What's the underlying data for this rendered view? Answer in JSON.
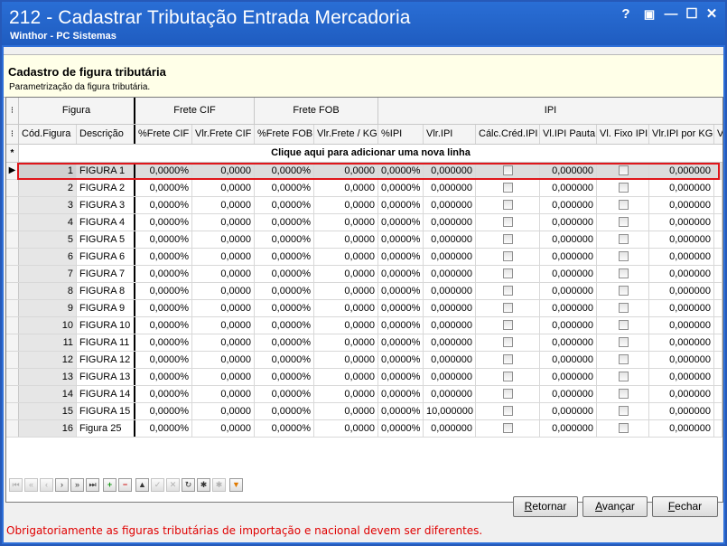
{
  "window": {
    "title": "212 - Cadastrar Tributação Entrada Mercadoria",
    "subtitle": "Winthor - PC Sistemas",
    "controls": [
      "?",
      "▣",
      "—",
      "☐",
      "✕"
    ]
  },
  "header": {
    "title": "Cadastro de figura tributária",
    "subtitle": "Parametrização da figura tributária."
  },
  "grid": {
    "bands": [
      "Figura",
      "Frete CIF",
      "Frete FOB",
      "IPI"
    ],
    "columns": [
      "Cód.Figura",
      "Descrição",
      "%Frete CIF",
      "Vlr.Frete CIF",
      "%Frete FOB",
      "Vlr.Frete / KG",
      "%IPI",
      "Vlr.IPI",
      "Cálc.Créd.IPI",
      "Vl.IPI Pauta",
      "Vl. Fixo IPI",
      "Vlr.IPI por KG",
      "V"
    ],
    "new_row_text": "Clique aqui para adicionar uma nova linha",
    "rows": [
      {
        "code": "1",
        "desc": "FIGURA 1",
        "frete_cif_pct": "0,0000%",
        "frete_cif_vlr": "0,0000",
        "frete_fob_pct": "0,0000%",
        "frete_kg": "0,0000",
        "ipi_pct": "0,0000%",
        "ipi_vlr": "0,000000",
        "ipi_pauta": "0,000000",
        "ipi_kg": "0,000000"
      },
      {
        "code": "2",
        "desc": "FIGURA 2",
        "frete_cif_pct": "0,0000%",
        "frete_cif_vlr": "0,0000",
        "frete_fob_pct": "0,0000%",
        "frete_kg": "0,0000",
        "ipi_pct": "0,0000%",
        "ipi_vlr": "0,000000",
        "ipi_pauta": "0,000000",
        "ipi_kg": "0,000000"
      },
      {
        "code": "3",
        "desc": "FIGURA 3",
        "frete_cif_pct": "0,0000%",
        "frete_cif_vlr": "0,0000",
        "frete_fob_pct": "0,0000%",
        "frete_kg": "0,0000",
        "ipi_pct": "0,0000%",
        "ipi_vlr": "0,000000",
        "ipi_pauta": "0,000000",
        "ipi_kg": "0,000000"
      },
      {
        "code": "4",
        "desc": "FIGURA 4",
        "frete_cif_pct": "0,0000%",
        "frete_cif_vlr": "0,0000",
        "frete_fob_pct": "0,0000%",
        "frete_kg": "0,0000",
        "ipi_pct": "0,0000%",
        "ipi_vlr": "0,000000",
        "ipi_pauta": "0,000000",
        "ipi_kg": "0,000000"
      },
      {
        "code": "5",
        "desc": "FIGURA 5",
        "frete_cif_pct": "0,0000%",
        "frete_cif_vlr": "0,0000",
        "frete_fob_pct": "0,0000%",
        "frete_kg": "0,0000",
        "ipi_pct": "0,0000%",
        "ipi_vlr": "0,000000",
        "ipi_pauta": "0,000000",
        "ipi_kg": "0,000000"
      },
      {
        "code": "6",
        "desc": "FIGURA 6",
        "frete_cif_pct": "0,0000%",
        "frete_cif_vlr": "0,0000",
        "frete_fob_pct": "0,0000%",
        "frete_kg": "0,0000",
        "ipi_pct": "0,0000%",
        "ipi_vlr": "0,000000",
        "ipi_pauta": "0,000000",
        "ipi_kg": "0,000000"
      },
      {
        "code": "7",
        "desc": "FIGURA 7",
        "frete_cif_pct": "0,0000%",
        "frete_cif_vlr": "0,0000",
        "frete_fob_pct": "0,0000%",
        "frete_kg": "0,0000",
        "ipi_pct": "0,0000%",
        "ipi_vlr": "0,000000",
        "ipi_pauta": "0,000000",
        "ipi_kg": "0,000000"
      },
      {
        "code": "8",
        "desc": "FIGURA 8",
        "frete_cif_pct": "0,0000%",
        "frete_cif_vlr": "0,0000",
        "frete_fob_pct": "0,0000%",
        "frete_kg": "0,0000",
        "ipi_pct": "0,0000%",
        "ipi_vlr": "0,000000",
        "ipi_pauta": "0,000000",
        "ipi_kg": "0,000000"
      },
      {
        "code": "9",
        "desc": "FIGURA 9",
        "frete_cif_pct": "0,0000%",
        "frete_cif_vlr": "0,0000",
        "frete_fob_pct": "0,0000%",
        "frete_kg": "0,0000",
        "ipi_pct": "0,0000%",
        "ipi_vlr": "0,000000",
        "ipi_pauta": "0,000000",
        "ipi_kg": "0,000000"
      },
      {
        "code": "10",
        "desc": "FIGURA 10",
        "frete_cif_pct": "0,0000%",
        "frete_cif_vlr": "0,0000",
        "frete_fob_pct": "0,0000%",
        "frete_kg": "0,0000",
        "ipi_pct": "0,0000%",
        "ipi_vlr": "0,000000",
        "ipi_pauta": "0,000000",
        "ipi_kg": "0,000000"
      },
      {
        "code": "11",
        "desc": "FIGURA 11",
        "frete_cif_pct": "0,0000%",
        "frete_cif_vlr": "0,0000",
        "frete_fob_pct": "0,0000%",
        "frete_kg": "0,0000",
        "ipi_pct": "0,0000%",
        "ipi_vlr": "0,000000",
        "ipi_pauta": "0,000000",
        "ipi_kg": "0,000000"
      },
      {
        "code": "12",
        "desc": "FIGURA 12",
        "frete_cif_pct": "0,0000%",
        "frete_cif_vlr": "0,0000",
        "frete_fob_pct": "0,0000%",
        "frete_kg": "0,0000",
        "ipi_pct": "0,0000%",
        "ipi_vlr": "0,000000",
        "ipi_pauta": "0,000000",
        "ipi_kg": "0,000000"
      },
      {
        "code": "13",
        "desc": "FIGURA 13",
        "frete_cif_pct": "0,0000%",
        "frete_cif_vlr": "0,0000",
        "frete_fob_pct": "0,0000%",
        "frete_kg": "0,0000",
        "ipi_pct": "0,0000%",
        "ipi_vlr": "0,000000",
        "ipi_pauta": "0,000000",
        "ipi_kg": "0,000000"
      },
      {
        "code": "14",
        "desc": "FIGURA 14",
        "frete_cif_pct": "0,0000%",
        "frete_cif_vlr": "0,0000",
        "frete_fob_pct": "0,0000%",
        "frete_kg": "0,0000",
        "ipi_pct": "0,0000%",
        "ipi_vlr": "0,000000",
        "ipi_pauta": "0,000000",
        "ipi_kg": "0,000000"
      },
      {
        "code": "15",
        "desc": "FIGURA 15",
        "frete_cif_pct": "0,0000%",
        "frete_cif_vlr": "0,0000",
        "frete_fob_pct": "0,0000%",
        "frete_kg": "0,0000",
        "ipi_pct": "0,0000%",
        "ipi_vlr": "10,000000",
        "ipi_pauta": "0,000000",
        "ipi_kg": "0,000000"
      },
      {
        "code": "16",
        "desc": "Figura 25",
        "frete_cif_pct": "0,0000%",
        "frete_cif_vlr": "0,0000",
        "frete_fob_pct": "0,0000%",
        "frete_kg": "0,0000",
        "ipi_pct": "0,0000%",
        "ipi_vlr": "0,000000",
        "ipi_pauta": "0,000000",
        "ipi_kg": "0,000000"
      }
    ],
    "selected_row": "1"
  },
  "navigator": {
    "buttons": [
      "⏮",
      "«",
      "‹",
      "›",
      "»",
      "⏭",
      "+",
      "−",
      "▲",
      "✓",
      "✕",
      "↻",
      "✱",
      "✱",
      "▼"
    ]
  },
  "actions": {
    "retornar": "Retornar",
    "avancar": "Avançar",
    "fechar": "Fechar"
  },
  "warning": "Obrigatoriamente as figuras tributárias de importação e nacional devem ser diferentes.",
  "colors": {
    "title_bar": "#1f5cc0",
    "header_panel": "#ffffe8",
    "selection_outline": "#e0161b",
    "warning_text": "#e00000"
  }
}
